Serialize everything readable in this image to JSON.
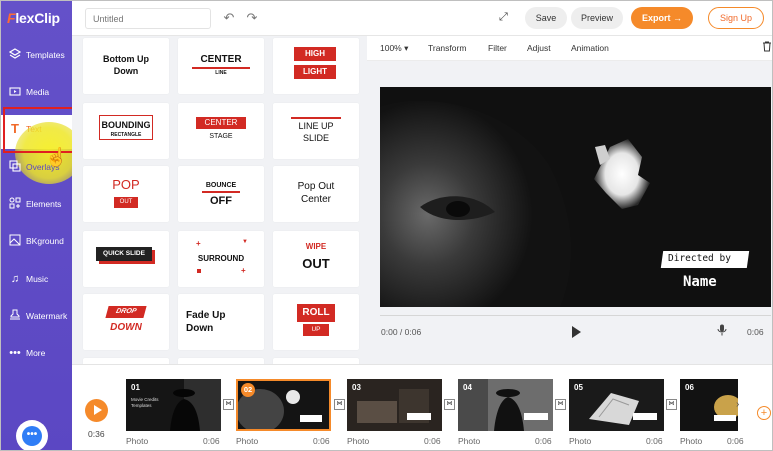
{
  "brand": {
    "logo_text_a": "F",
    "logo_text_b": "lexClip"
  },
  "sidebar": {
    "items": [
      {
        "label": "Templates",
        "icon": "layers-icon"
      },
      {
        "label": "Media",
        "icon": "folder-icon"
      },
      {
        "label": "Text",
        "icon": "text-icon"
      },
      {
        "label": "Overlays",
        "icon": "overlay-icon"
      },
      {
        "label": "Elements",
        "icon": "shapes-icon"
      },
      {
        "label": "BKground",
        "icon": "image-icon"
      },
      {
        "label": "Music",
        "icon": "music-icon"
      },
      {
        "label": "Watermark",
        "icon": "stamp-icon"
      },
      {
        "label": "More",
        "icon": "more-icon"
      }
    ],
    "active": "Text"
  },
  "topbar": {
    "title_placeholder": "Untitled",
    "save_label": "Save",
    "preview_label": "Preview",
    "export_label": "Export →",
    "signup_label": "Sign Up"
  },
  "templates": {
    "cards": [
      {
        "lines": [
          "Bottom Up",
          "Down"
        ]
      },
      {
        "lines": [
          "CENTER",
          "LINE"
        ]
      },
      {
        "lines": [
          "HIGH",
          "LIGHT"
        ]
      },
      {
        "lines": [
          "BOUNDING",
          "RECTANGLE"
        ]
      },
      {
        "lines": [
          "CENTER",
          "STAGE"
        ]
      },
      {
        "lines": [
          "LINE UP",
          "SLIDE"
        ]
      },
      {
        "lines": [
          "POP",
          "OUT"
        ]
      },
      {
        "lines": [
          "BOUNCE",
          "OFF"
        ]
      },
      {
        "lines": [
          "Pop Out",
          "Center"
        ]
      },
      {
        "lines": [
          "QUICK SLIDE"
        ]
      },
      {
        "lines": [
          "SURROUND"
        ]
      },
      {
        "lines": [
          "WIPE",
          "OUT"
        ]
      },
      {
        "lines": [
          "DROP",
          "DOWN"
        ]
      },
      {
        "lines": [
          "Fade Up",
          "Down"
        ]
      },
      {
        "lines": [
          "ROLL",
          "UP"
        ]
      }
    ]
  },
  "edit_bar": {
    "zoom": "100%",
    "items": [
      "Transform",
      "Filter",
      "Adjust",
      "Animation"
    ]
  },
  "preview": {
    "directed_by": "Directed by",
    "name": "Name",
    "current_time": "0:00 / 0:06",
    "duration": "0:06"
  },
  "timeline": {
    "total_time": "0:36",
    "clips": [
      {
        "num": "01",
        "type": "Photo",
        "duration": "0:06",
        "caption": "Movie Credits Templates"
      },
      {
        "num": "02",
        "type": "Photo",
        "duration": "0:06"
      },
      {
        "num": "03",
        "type": "Photo",
        "duration": "0:06"
      },
      {
        "num": "04",
        "type": "Photo",
        "duration": "0:06"
      },
      {
        "num": "05",
        "type": "Photo",
        "duration": "0:06"
      },
      {
        "num": "06",
        "type": "Photo",
        "duration": "0:06"
      }
    ]
  },
  "colors": {
    "sidebar": "#6451c9",
    "accent": "#f58a2a",
    "red": "#d22a23"
  }
}
